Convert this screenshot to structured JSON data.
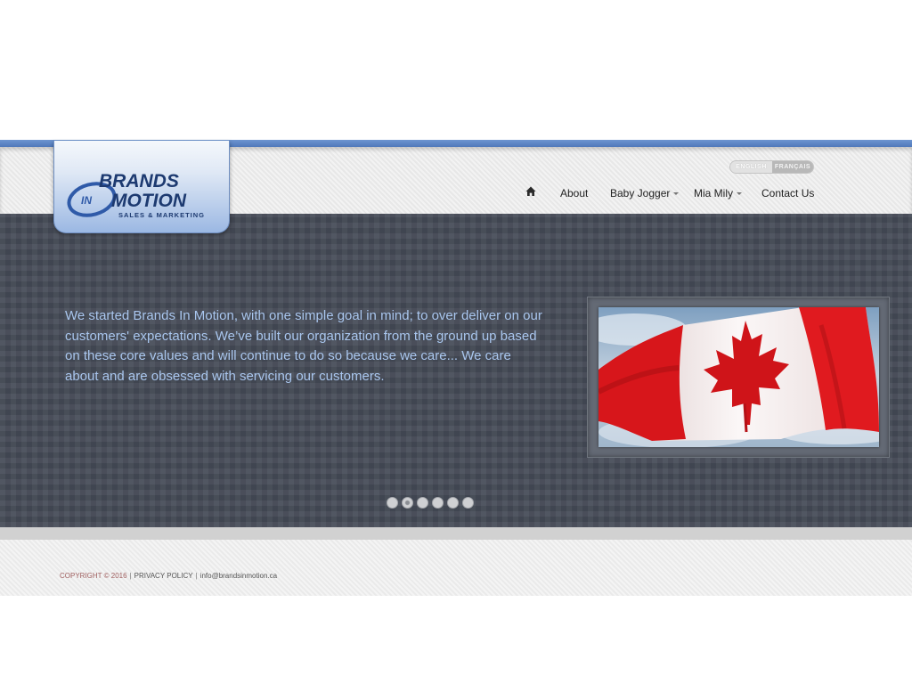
{
  "brand": {
    "logo_line1": "BRANDS",
    "logo_in": "IN",
    "logo_line2": "MOTION",
    "logo_tagline": "SALES & MARKETING"
  },
  "language": {
    "english": "ENGLISH",
    "french": "FRANÇAIS"
  },
  "nav": {
    "home_icon": "home-icon",
    "about": "About",
    "baby_jogger": "Baby Jogger",
    "mia_mily": "Mia Mily",
    "contact": "Contact Us"
  },
  "hero": {
    "text": "We started Brands In Motion, with one simple goal in mind; to over deliver on our customers' expectations. We’ve built our organization from the ground up based on these core values and will continue to do so because we care... We care about and are obsessed with servicing our customers.",
    "slide_count": 6,
    "active_slide": 2
  },
  "footer": {
    "copyright": "COPYRIGHT © 2016",
    "privacy": "PRIVACY POLICY",
    "email": "info@brandsinmotion.ca",
    "separator": "|"
  },
  "colors": {
    "accent_blue": "#5a83c4",
    "hero_bg": "#454b57",
    "hero_text": "#a9c6ee",
    "logo_text": "#1f3f7a"
  }
}
